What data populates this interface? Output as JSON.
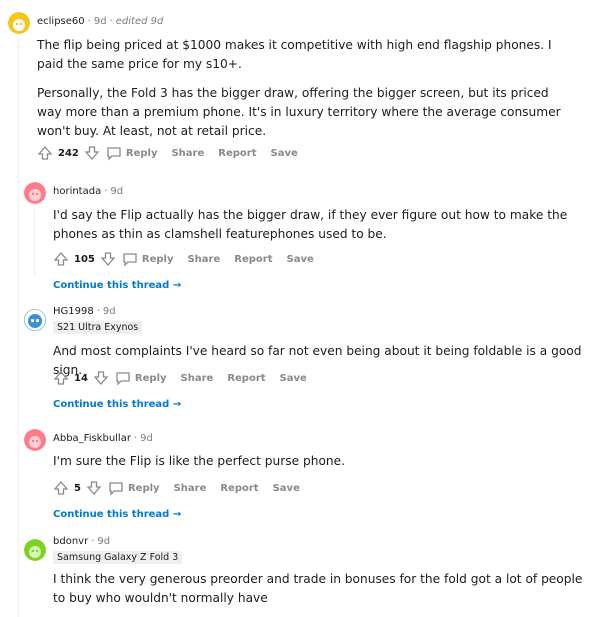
{
  "comments": [
    {
      "user": "eclipse60",
      "time": "9d",
      "edited": "edited 9d",
      "avatar_color": "#f5c518",
      "paragraphs": [
        "The flip being priced at $1000 makes it competitive with high end flagship phones. I paid the same price for my s10+.",
        "Personally, the Fold 3 has the bigger draw, offering the bigger screen, but its priced way more than a premium phone. It's in luxury territory where the average consumer won't buy. At least, not at retail price."
      ],
      "score": "242"
    },
    {
      "user": "horintada",
      "time": "9d",
      "avatar_color": "#ff7b8a",
      "paragraphs": [
        "I'd say the Flip actually has the bigger draw, if they ever figure out how to make the phones as thin as clamshell featurephones used to be."
      ],
      "score": "105"
    },
    {
      "user": "HG1998",
      "time": "9d",
      "flair": "S21 Ultra Exynos",
      "avatar_color": "#3b8fd6",
      "paragraphs": [
        "And most complaints I've heard so far not even being about it being foldable is a good sign."
      ],
      "score": "14"
    },
    {
      "user": "Abba_Fiskbullar",
      "time": "9d",
      "avatar_color": "#ff7b8a",
      "paragraphs": [
        "I'm sure the Flip is like the perfect purse phone."
      ],
      "score": "5"
    },
    {
      "user": "bdonvr",
      "time": "9d",
      "flair": "Samsung Galaxy Z Fold 3",
      "avatar_color": "#7ed321",
      "paragraphs": [
        "I think the very generous preorder and trade in bonuses for the fold got a lot of people to buy who wouldn't normally have"
      ]
    }
  ],
  "actions": {
    "reply": "Reply",
    "share": "Share",
    "report": "Report",
    "save": "Save"
  },
  "continue_thread": "Continue this thread",
  "separator": "·",
  "arrow": "→"
}
